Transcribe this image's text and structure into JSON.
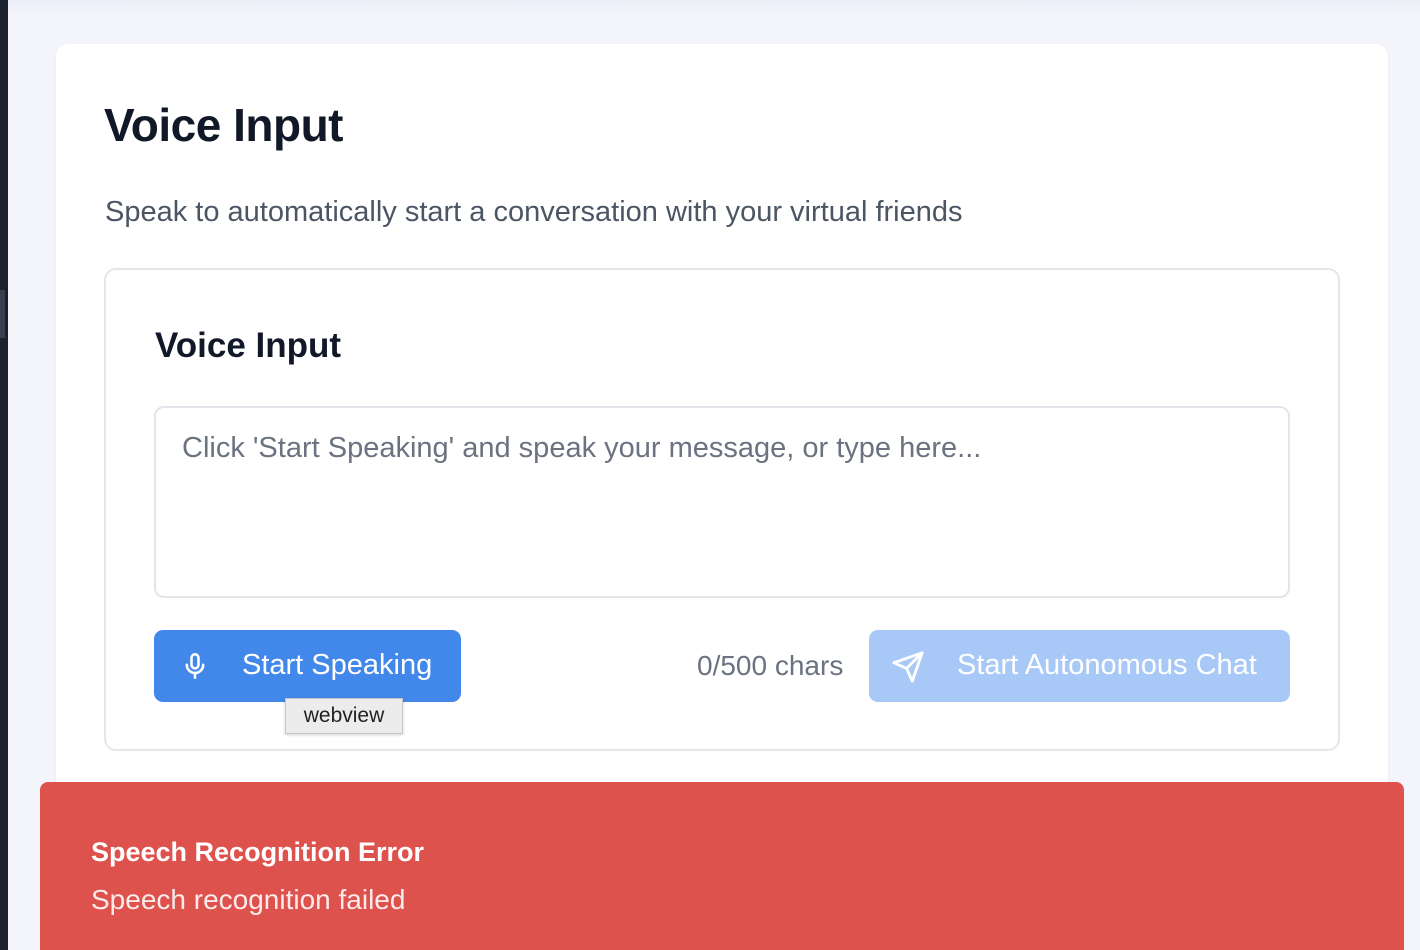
{
  "page": {
    "title": "Voice Input",
    "subtitle": "Speak to automatically start a conversation with your virtual friends"
  },
  "voice_panel": {
    "title": "Voice Input",
    "input": {
      "value": "",
      "placeholder": "Click 'Start Speaking' and speak your message, or type here..."
    },
    "speak_button": {
      "label": "Start Speaking",
      "icon": "microphone-icon"
    },
    "tooltip": "webview",
    "char_count": "0/500 chars",
    "chat_button": {
      "label": "Start Autonomous Chat",
      "icon": "send-icon",
      "disabled": true
    }
  },
  "toast": {
    "title": "Speech Recognition Error",
    "message": "Speech recognition failed"
  },
  "colors": {
    "primary": "#4287ea",
    "primary_disabled": "#a8c8f7",
    "error": "#de524e",
    "heading": "#111827",
    "muted": "#6b7280"
  }
}
